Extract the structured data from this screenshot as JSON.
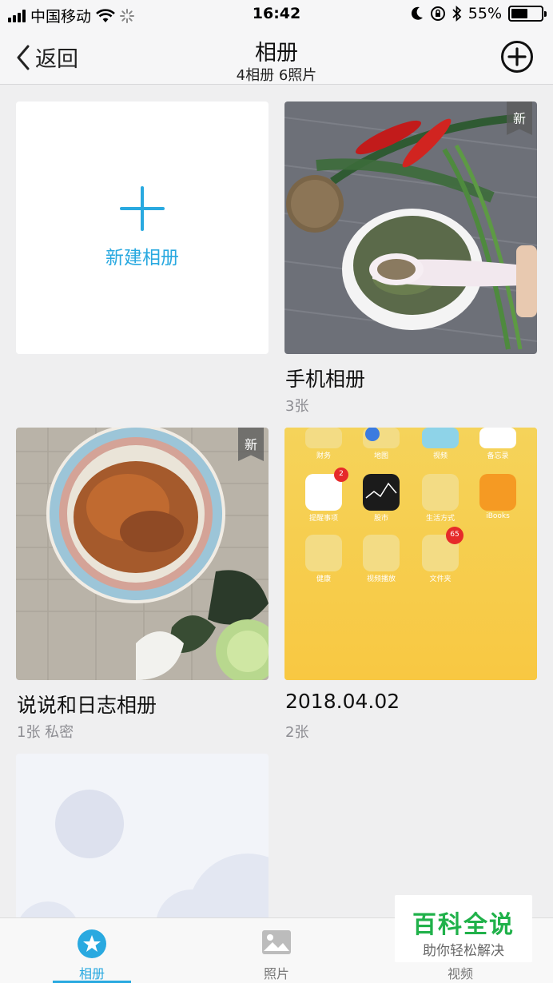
{
  "status": {
    "carrier": "中国移动",
    "time": "16:42",
    "battery": "55%",
    "battery_level": 0.55
  },
  "nav": {
    "back_label": "返回",
    "title": "相册",
    "subtitle": "4相册 6照片"
  },
  "new_album": {
    "label": "新建相册"
  },
  "albums": [
    {
      "title": "手机相册",
      "meta": "3张",
      "badge": "新"
    },
    {
      "title": "说说和日志相册",
      "meta": "1张  私密",
      "badge": "新"
    },
    {
      "title": "2018.04.02",
      "meta": "2张"
    }
  ],
  "screenshot_thumb": {
    "apps": [
      "财务",
      "地图",
      "视频",
      "备忘录",
      "提醒事项",
      "股市",
      "生活方式",
      "iBooks",
      "健康",
      "视频播放",
      "文件夹"
    ],
    "badges": [
      "2",
      "65"
    ]
  },
  "tabs": [
    {
      "label": "相册",
      "active": true
    },
    {
      "label": "照片"
    },
    {
      "label": "视频"
    }
  ],
  "watermark": {
    "title": "百科全说",
    "subtitle": "助你轻松解决"
  },
  "colors": {
    "accent": "#29a9e0",
    "background": "#efeff0",
    "watermark_green": "#20b14a"
  }
}
